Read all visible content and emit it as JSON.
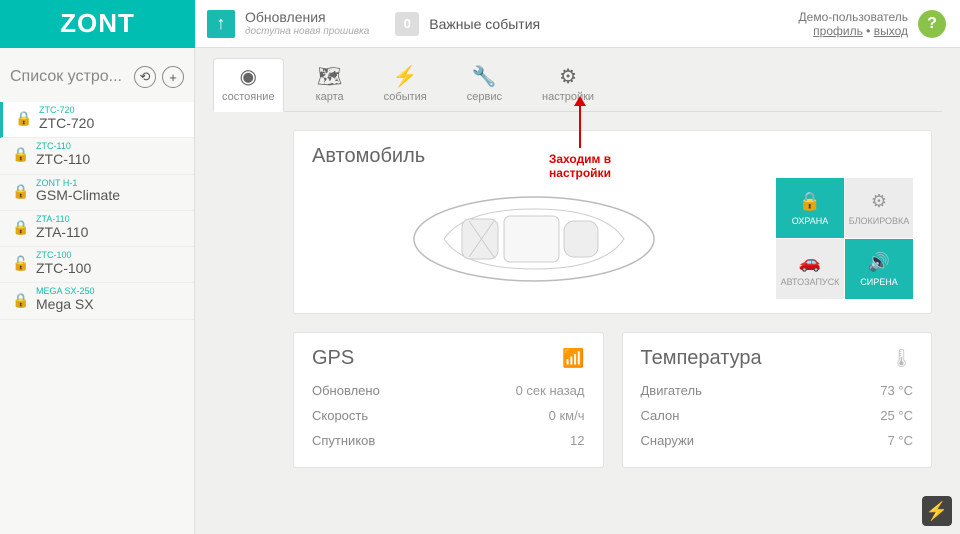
{
  "header": {
    "logo": "ZONT",
    "update_title": "Обновления",
    "update_sub": "доступна новая прошивка",
    "events_count": "0",
    "events_label": "Важные события",
    "user_name": "Демо-пользователь",
    "profile_link": "профиль",
    "logout_link": "выход",
    "help": "?"
  },
  "sidebar": {
    "title": "Список устро...",
    "devices": [
      {
        "code": "ZTC-720",
        "name": "ZTC-720",
        "locked": true
      },
      {
        "code": "ZTC-110",
        "name": "ZTC-110",
        "locked": true
      },
      {
        "code": "ZONT H-1",
        "name": "GSM-Climate",
        "locked": true
      },
      {
        "code": "ZTA-110",
        "name": "ZTA-110",
        "locked": true
      },
      {
        "code": "ZTC-100",
        "name": "ZTC-100",
        "locked": false
      },
      {
        "code": "MEGA SX-250",
        "name": "Mega SX",
        "locked": true
      }
    ]
  },
  "tabs": [
    {
      "id": "state",
      "label": "состояние"
    },
    {
      "id": "map",
      "label": "карта"
    },
    {
      "id": "events",
      "label": "события"
    },
    {
      "id": "service",
      "label": "сервис"
    },
    {
      "id": "settings",
      "label": "настройки"
    }
  ],
  "annotation": "Заходим в настройки",
  "car": {
    "title": "Автомобиль",
    "controls": [
      {
        "id": "guard",
        "label": "ОХРАНА",
        "on": true,
        "icon": "lock"
      },
      {
        "id": "block",
        "label": "БЛОКИРОВКА",
        "on": false,
        "icon": "engine"
      },
      {
        "id": "autostart",
        "label": "АВТОЗАПУСК",
        "on": false,
        "icon": "car"
      },
      {
        "id": "siren",
        "label": "СИРЕНА",
        "on": true,
        "icon": "sound"
      }
    ]
  },
  "gps": {
    "title": "GPS",
    "rows": [
      {
        "k": "Обновлено",
        "v": "0 сек назад"
      },
      {
        "k": "Скорость",
        "v": "0 км/ч"
      },
      {
        "k": "Спутников",
        "v": "12"
      }
    ]
  },
  "temp": {
    "title": "Температура",
    "rows": [
      {
        "k": "Двигатель",
        "v": "73 °C"
      },
      {
        "k": "Салон",
        "v": "25 °C"
      },
      {
        "k": "Снаружи",
        "v": "7 °C"
      }
    ]
  }
}
